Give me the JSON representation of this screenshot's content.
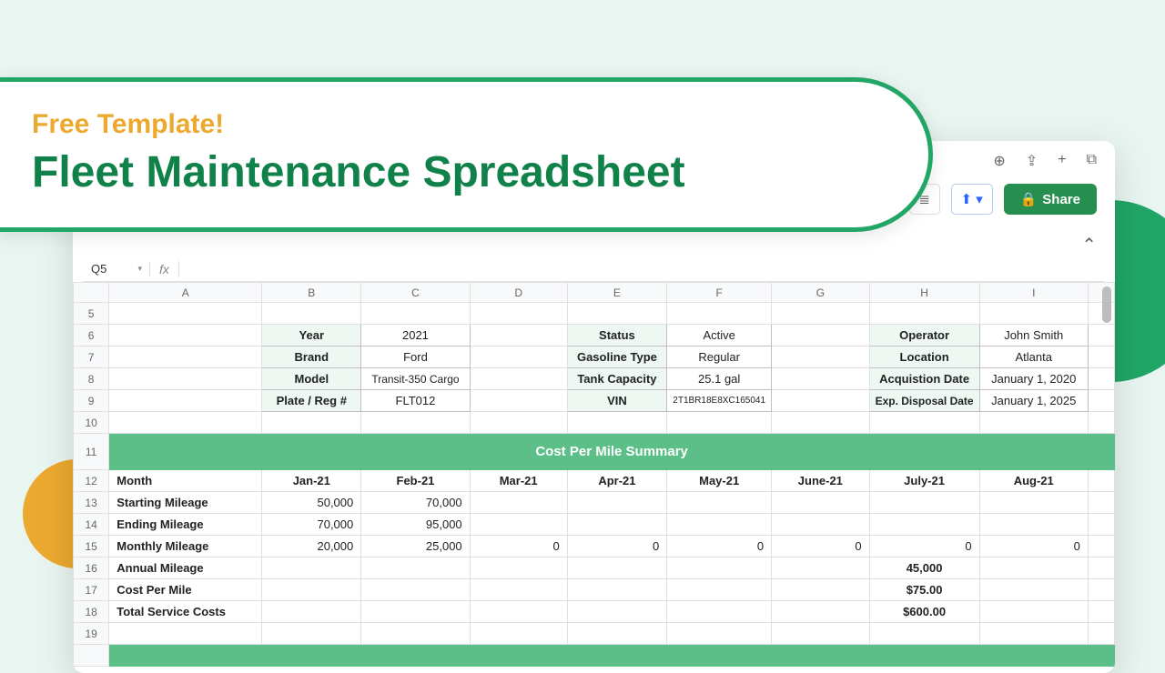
{
  "hero": {
    "eyebrow": "Free Template!",
    "headline": "Fleet Maintenance Spreadsheet"
  },
  "toolbar": {
    "share": "Share"
  },
  "formula": {
    "cellref": "Q5"
  },
  "cols": [
    "A",
    "B",
    "C",
    "D",
    "E",
    "F",
    "G",
    "H",
    "I"
  ],
  "rownums": [
    "5",
    "6",
    "7",
    "8",
    "9",
    "10",
    "11",
    "12",
    "13",
    "14",
    "15",
    "16",
    "17",
    "18",
    "19"
  ],
  "info": {
    "left_labels": [
      "Year",
      "Brand",
      "Model",
      "Plate / Reg #"
    ],
    "left_vals": [
      "2021",
      "Ford",
      "Transit-350 Cargo",
      "FLT012"
    ],
    "mid_labels": [
      "Status",
      "Gasoline Type",
      "Tank Capacity",
      "VIN"
    ],
    "mid_vals": [
      "Active",
      "Regular",
      "25.1 gal",
      "2T1BR18E8XC165041"
    ],
    "right_labels": [
      "Operator",
      "Location",
      "Acquistion Date",
      "Exp. Disposal Date"
    ],
    "right_vals": [
      "John Smith",
      "Atlanta",
      "January 1, 2020",
      "January 1, 2025"
    ]
  },
  "summary_title": "Cost Per Mile Summary",
  "months": [
    "Jan-21",
    "Feb-21",
    "Mar-21",
    "Apr-21",
    "May-21",
    "June-21",
    "July-21",
    "Aug-21"
  ],
  "rows": {
    "month_label": "Month",
    "start_label": "Starting Mileage",
    "end_label": "Ending Mileage",
    "monthly_label": "Monthly Mileage",
    "annual_label": "Annual Mileage",
    "cpm_label": "Cost Per Mile",
    "tsc_label": "Total Service Costs",
    "start": [
      "50,000",
      "70,000",
      "",
      "",
      "",
      "",
      "",
      ""
    ],
    "end": [
      "70,000",
      "95,000",
      "",
      "",
      "",
      "",
      "",
      ""
    ],
    "monthly": [
      "20,000",
      "25,000",
      "0",
      "0",
      "0",
      "0",
      "0",
      "0"
    ],
    "annual": "45,000",
    "cpm": "$75.00",
    "tsc": "$600.00"
  }
}
